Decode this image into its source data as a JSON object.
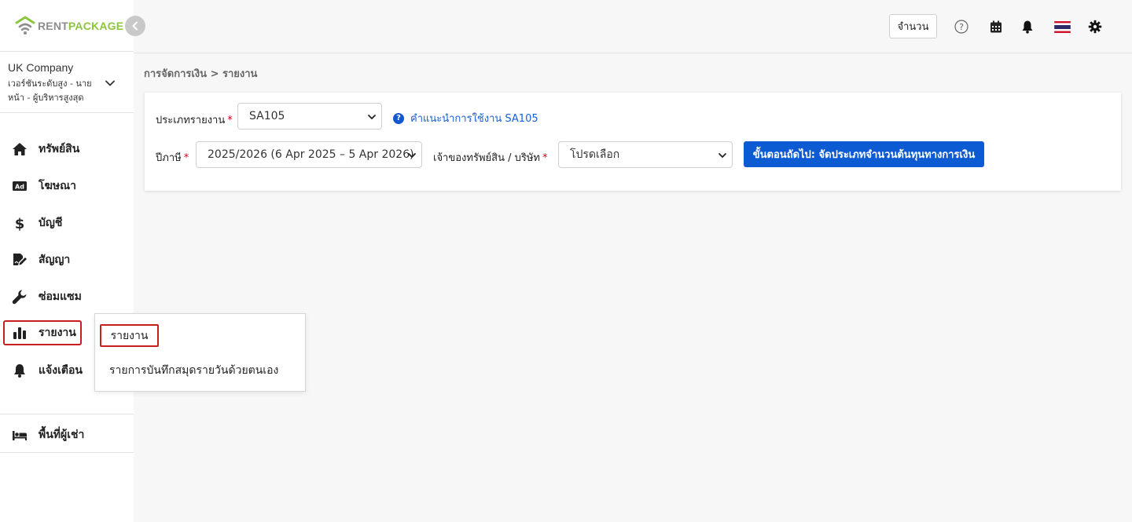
{
  "brand": {
    "part1": "RENT",
    "part2": "PACKAGE",
    "accent": "#8cc63f"
  },
  "company": {
    "name": "UK Company",
    "role": "เวอร์ชันระดับสูง - นายหน้า - ผู้บริหารสูงสุด"
  },
  "sidebar": {
    "items": [
      {
        "label": "ทรัพย์สิน",
        "icon": "home-icon"
      },
      {
        "label": "โฆษณา",
        "icon": "ad-icon"
      },
      {
        "label": "บัญชี",
        "icon": "dollar-icon"
      },
      {
        "label": "สัญญา",
        "icon": "contract-icon"
      },
      {
        "label": "ซ่อมแซม",
        "icon": "wrench-icon"
      },
      {
        "label": "รายงาน",
        "icon": "chart-icon",
        "active": true
      },
      {
        "label": "แจ้งเตือน",
        "icon": "bell-icon"
      }
    ],
    "tenant_item": {
      "label": "พื้นที่ผู้เช่า",
      "icon": "bed-icon"
    }
  },
  "header": {
    "count_label": "จำนวน"
  },
  "breadcrumb": "การจัดการเงิน > รายงาน",
  "form": {
    "report_type_label": "ประเภทรายงาน",
    "report_type_value": "SA105",
    "help_text": "คำแนะนำการใช้งาน SA105",
    "tax_year_label": "ปีภาษี",
    "tax_year_value": "2025/2026 (6 Apr 2025 – 5 Apr 2026)",
    "owner_label": "เจ้าของทรัพย์สิน / บริษัท",
    "owner_value": "โปรดเลือก",
    "required_mark": "*",
    "next_button": "ขั้นตอนถัดไป: จัดประเภทจำนวนต้นทุนทางการเงิน"
  },
  "submenu": {
    "items": [
      "รายงาน",
      "รายการบันทึกสมุดรายวันด้วยตนเอง"
    ]
  }
}
